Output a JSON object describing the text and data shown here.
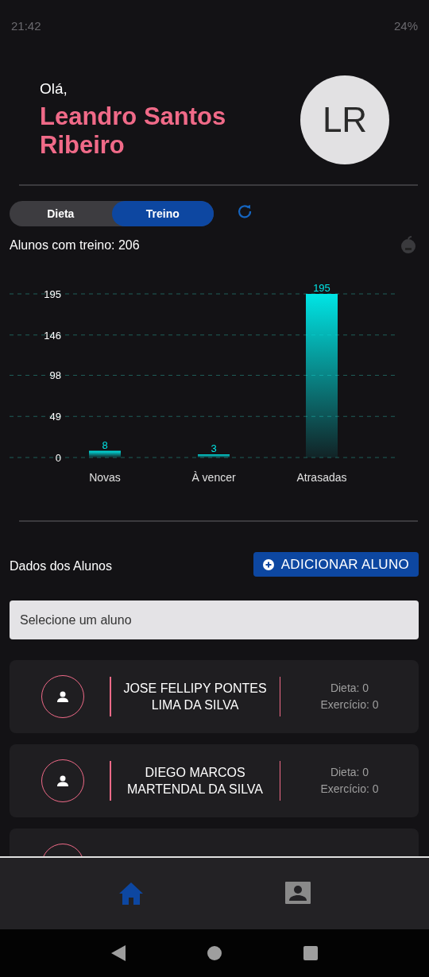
{
  "status_bar": {
    "time": "21:42",
    "battery": "24%"
  },
  "header": {
    "greeting": "Olá,",
    "user_name": "Leandro Santos Ribeiro",
    "avatar_initials": "LR"
  },
  "mode_toggle": [
    {
      "label": "Dieta",
      "selected": false
    },
    {
      "label": "Treino",
      "selected": true
    }
  ],
  "summary": "Alunos com treino: 206",
  "chart": {
    "chart_data": {
      "type": "bar",
      "categories": [
        "Novas",
        "À vencer",
        "Atrasadas"
      ],
      "series": [
        {
          "color": "#00e5e5",
          "values": [
            8,
            3,
            195
          ]
        }
      ],
      "ylim": [
        0,
        195
      ],
      "yticks": [
        0,
        49,
        98,
        146,
        195
      ],
      "data_labels": true,
      "grid": true
    }
  },
  "students_section": {
    "title": "Dados dos Alunos",
    "add_button": "ADICIONAR ALUNO",
    "select_placeholder": "Selecione um aluno"
  },
  "students": [
    {
      "name": "JOSE FELLIPY PONTES LIMA DA SILVA",
      "diet": "Dieta: 0",
      "exercise": "Exercício: 0"
    },
    {
      "name": "DIEGO MARCOS MARTENDAL DA SILVA",
      "diet": "Dieta: 0",
      "exercise": "Exercício: 0"
    },
    {
      "kind": "partial"
    }
  ],
  "bottom_nav": [
    {
      "selected": true
    },
    {
      "selected": false
    }
  ]
}
